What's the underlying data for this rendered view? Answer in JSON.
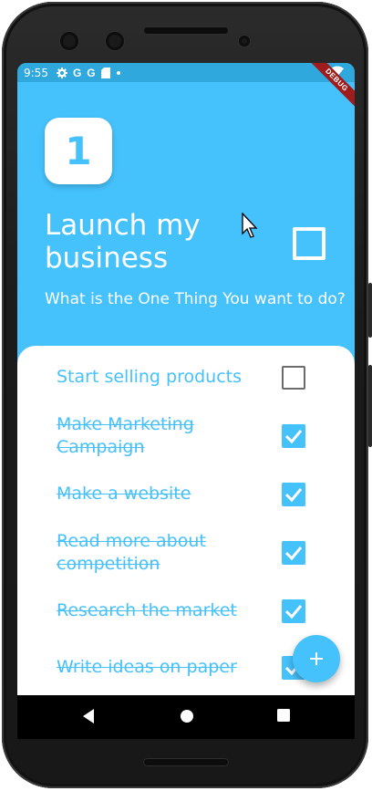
{
  "status_bar": {
    "time": "9:55",
    "icons": [
      "gear-icon",
      "google-icon",
      "google-icon",
      "sd-card-icon",
      "dot-icon"
    ],
    "g1": "G",
    "g2": "G",
    "right_icons": [
      "wifi-icon",
      "signal-icon",
      "battery-icon"
    ]
  },
  "debug_banner": "DEBUG",
  "header": {
    "number": "1",
    "title": "Launch my business",
    "subtitle": "What is the One Thing You want to do?",
    "completed": false
  },
  "tasks": [
    {
      "label": "Start selling products",
      "done": false
    },
    {
      "label": "Make Marketing Campaign",
      "done": true
    },
    {
      "label": "Make a website",
      "done": true
    },
    {
      "label": "Read more about competition",
      "done": true
    },
    {
      "label": "Research the market",
      "done": true
    },
    {
      "label": "Write ideas on paper",
      "done": true
    }
  ],
  "fab": {
    "icon": "plus-icon"
  },
  "nav": [
    "back-icon",
    "home-icon",
    "recents-icon"
  ],
  "colors": {
    "accent": "#45c1fb",
    "status_bar": "#2fa8de",
    "unchecked_border": "#6b6b6b",
    "debug_ribbon": "#9e1c1c"
  }
}
